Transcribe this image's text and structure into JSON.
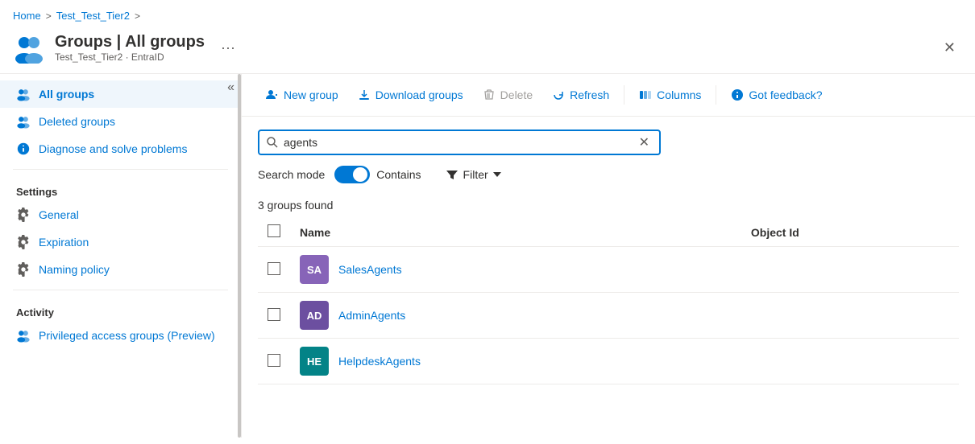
{
  "breadcrumb": {
    "home": "Home",
    "sep1": ">",
    "tier": "Test_Test_Tier2",
    "sep2": ">"
  },
  "header": {
    "title": "Groups | All groups",
    "subtitle": "Test_Test_Tier2  · EntraID",
    "more_icon": "···",
    "close_icon": "✕"
  },
  "sidebar": {
    "collapse_icon": "«",
    "nav_items": [
      {
        "id": "all-groups",
        "label": "All groups",
        "active": true
      },
      {
        "id": "deleted-groups",
        "label": "Deleted groups",
        "active": false
      },
      {
        "id": "diagnose",
        "label": "Diagnose and solve problems",
        "active": false
      }
    ],
    "settings_title": "Settings",
    "settings_items": [
      {
        "id": "general",
        "label": "General"
      },
      {
        "id": "expiration",
        "label": "Expiration"
      },
      {
        "id": "naming-policy",
        "label": "Naming policy"
      }
    ],
    "activity_title": "Activity",
    "activity_items": [
      {
        "id": "privileged-access",
        "label": "Privileged access groups (Preview)"
      }
    ]
  },
  "toolbar": {
    "new_group": "New group",
    "download_groups": "Download groups",
    "delete": "Delete",
    "refresh": "Refresh",
    "columns": "Columns",
    "got_feedback": "Got feedback?"
  },
  "search": {
    "value": "agents",
    "placeholder": "Search",
    "search_mode_label": "Search mode",
    "toggle_label": "Contains",
    "filter_label": "Filter"
  },
  "results": {
    "count_text": "3 groups found"
  },
  "table": {
    "columns": [
      "Name",
      "Object Id"
    ],
    "rows": [
      {
        "id": "sales-agents",
        "initials": "SA",
        "name": "SalesAgents",
        "avatar_color": "#8764b8",
        "object_id": ""
      },
      {
        "id": "admin-agents",
        "initials": "AD",
        "name": "AdminAgents",
        "avatar_color": "#6c4fa0",
        "object_id": ""
      },
      {
        "id": "helpdesk-agents",
        "initials": "HE",
        "name": "HelpdeskAgents",
        "avatar_color": "#038387",
        "object_id": ""
      }
    ]
  }
}
